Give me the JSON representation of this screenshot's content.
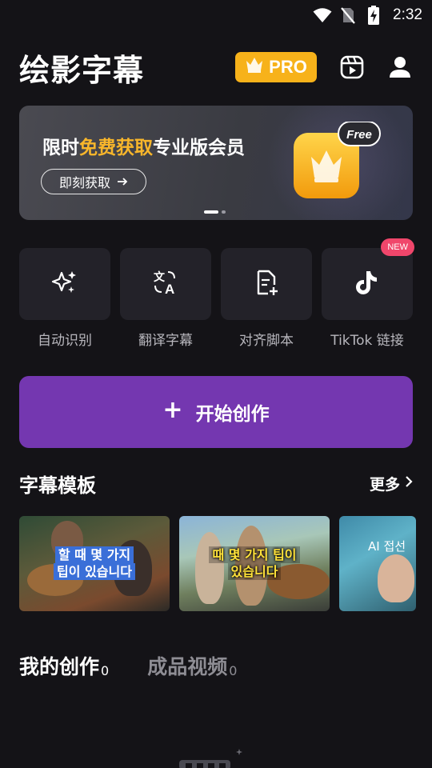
{
  "status_bar": {
    "time": "2:32",
    "icons": [
      "wifi-icon",
      "no-sim-icon",
      "battery-charging-icon"
    ]
  },
  "header": {
    "title": "绘影字幕",
    "pro_label": "PRO",
    "icons": [
      "crown-icon",
      "video-library-icon",
      "profile-icon"
    ]
  },
  "banner": {
    "text_prefix": "限时",
    "text_highlight": "免费获取",
    "text_suffix": "专业版会员",
    "button_label": "即刻获取",
    "badge_label": "Free",
    "accent_color": "#f8b62b",
    "page_count": 2,
    "active_page": 1
  },
  "tools": [
    {
      "label": "自动识别",
      "icon": "sparkle-icon"
    },
    {
      "label": "翻译字幕",
      "icon": "translate-icon"
    },
    {
      "label": "对齐脚本",
      "icon": "document-add-icon"
    },
    {
      "label": "TikTok 链接",
      "icon": "tiktok-icon",
      "badge": "NEW"
    }
  ],
  "start_button": {
    "label": "开始创作",
    "color": "#7437b0"
  },
  "templates": {
    "title": "字幕模板",
    "more_label": "更多",
    "items": [
      {
        "caption_line1": "할 때 몇 가지",
        "caption_line2": "팁이 있습니다"
      },
      {
        "caption_line1": "때 몇 가지 팁이",
        "caption_line2": "있습니다"
      },
      {
        "caption_line1": "AI 접선"
      }
    ]
  },
  "tabs": [
    {
      "label": "我的创作",
      "count": "0",
      "active": true
    },
    {
      "label": "成品视频",
      "count": "0",
      "active": false
    }
  ]
}
